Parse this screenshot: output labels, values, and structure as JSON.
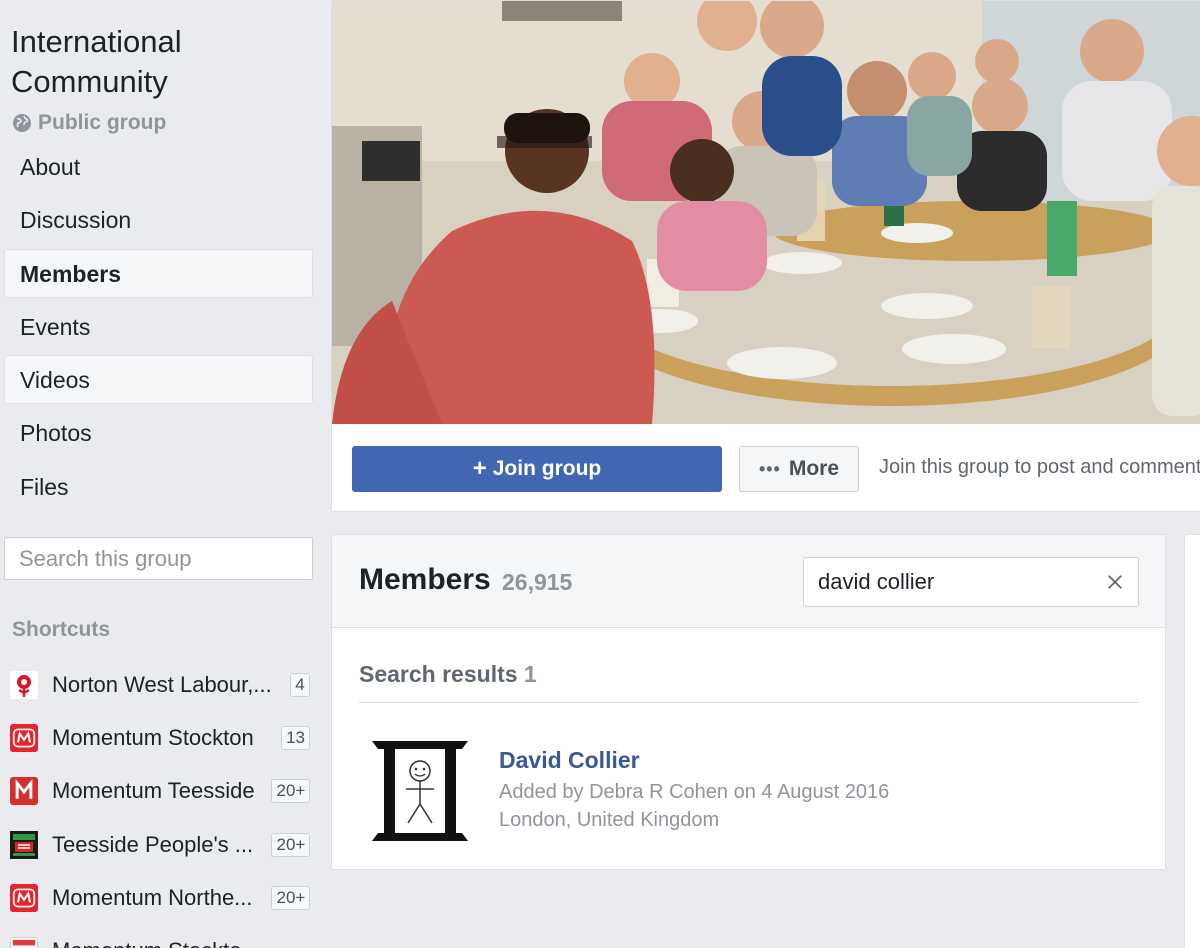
{
  "group": {
    "name": "International Community",
    "privacy": "Public group"
  },
  "nav": {
    "items": [
      {
        "label": "About"
      },
      {
        "label": "Discussion"
      },
      {
        "label": "Members"
      },
      {
        "label": "Events"
      },
      {
        "label": "Videos"
      },
      {
        "label": "Photos"
      },
      {
        "label": "Files"
      }
    ],
    "active": "Members"
  },
  "group_search": {
    "placeholder": "Search this group"
  },
  "shortcuts": {
    "header": "Shortcuts",
    "items": [
      {
        "label": "Norton West Labour,...",
        "count": "4",
        "icon": "labour-rose-icon",
        "color": "#d7152a"
      },
      {
        "label": "Momentum Stockton",
        "count": "13",
        "icon": "momentum-m-icon",
        "color": "#e3262d"
      },
      {
        "label": "Momentum Teesside",
        "count": "20+",
        "icon": "momentum-m-icon",
        "color": "#d32f2f"
      },
      {
        "label": "Teesside People's ...",
        "count": "20+",
        "icon": "workers-out-icon",
        "color": "#1b7a2b"
      },
      {
        "label": "Momentum Northe...",
        "count": "20+",
        "icon": "momentum-m-icon",
        "color": "#e3262d"
      },
      {
        "label": "Momentum Stockton m...",
        "count": "",
        "icon": "calendar-icon",
        "color": "#ffffff"
      }
    ]
  },
  "actions": {
    "join_label": "Join group",
    "more_label": "More",
    "hint": "Join this group to post and comment."
  },
  "members": {
    "title": "Members",
    "count": "26,915",
    "search_value": "david collier",
    "results_label": "Search results",
    "results_count": "1",
    "results": [
      {
        "name": "David Collier",
        "added": "Added by Debra R Cohen on 4 August 2016",
        "location": "London, United Kingdom"
      }
    ]
  },
  "colors": {
    "primary": "#4267b2",
    "link": "#385898",
    "background": "#e9ebee"
  }
}
